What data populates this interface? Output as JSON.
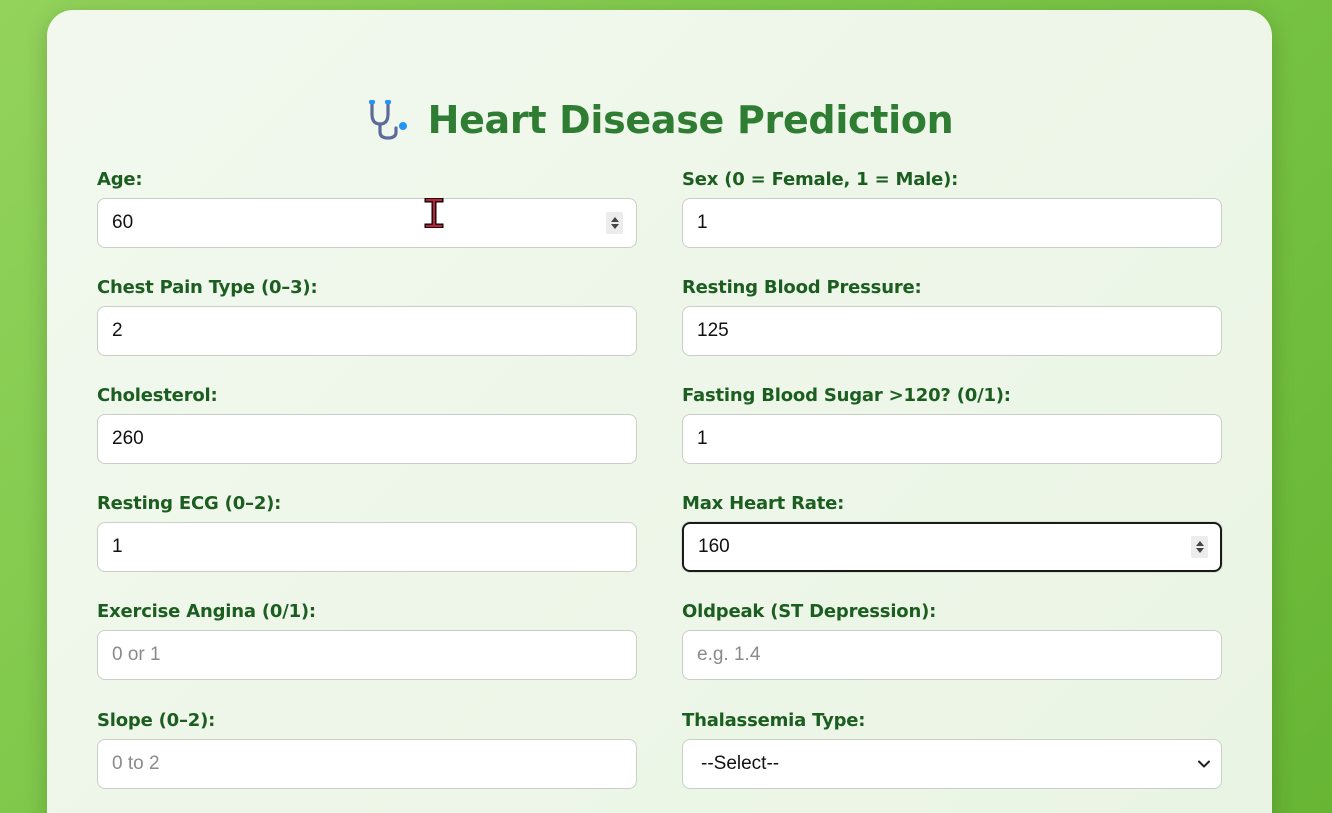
{
  "title": "Heart Disease Prediction",
  "title_icon": "stethoscope-icon",
  "colors": {
    "title": "#2e7d32",
    "label": "#1b5e20",
    "background": "#7ec84a",
    "card": "#eef6ea"
  },
  "fields": {
    "age": {
      "label": "Age:",
      "value": "60",
      "placeholder": ""
    },
    "sex": {
      "label": "Sex (0 = Female, 1 = Male):",
      "value": "1",
      "placeholder": ""
    },
    "chest_pain": {
      "label": "Chest Pain Type (0–3):",
      "value": "2",
      "placeholder": ""
    },
    "resting_bp": {
      "label": "Resting Blood Pressure:",
      "value": "125",
      "placeholder": ""
    },
    "cholesterol": {
      "label": "Cholesterol:",
      "value": "260",
      "placeholder": ""
    },
    "fasting_bs": {
      "label": "Fasting Blood Sugar >120? (0/1):",
      "value": "1",
      "placeholder": ""
    },
    "resting_ecg": {
      "label": "Resting ECG (0–2):",
      "value": "1",
      "placeholder": ""
    },
    "max_hr": {
      "label": "Max Heart Rate:",
      "value": "160",
      "placeholder": ""
    },
    "exercise_angina": {
      "label": "Exercise Angina (0/1):",
      "value": "",
      "placeholder": "0 or 1"
    },
    "oldpeak": {
      "label": "Oldpeak (ST Depression):",
      "value": "",
      "placeholder": "e.g. 1.4"
    },
    "slope": {
      "label": "Slope (0–2):",
      "value": "",
      "placeholder": "0 to 2"
    },
    "thalassemia": {
      "label": "Thalassemia Type:",
      "selected": "--Select--"
    }
  }
}
